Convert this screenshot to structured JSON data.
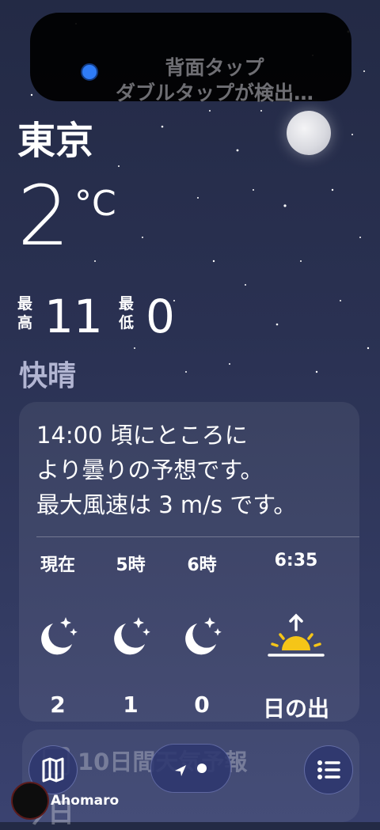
{
  "notification": {
    "line1": "背面タップ",
    "line2": "ダブルタップが検出…"
  },
  "weather": {
    "city": "東京",
    "temperature": "2",
    "degree_unit": "°C",
    "high_label": "最高",
    "high_value": "11",
    "low_label": "最低",
    "low_value": "0",
    "condition": "快晴"
  },
  "hourly_card": {
    "summary_line1": "14:00 頃にところに",
    "summary_line2": "より曇りの予想です。",
    "summary_line3": "最大風速は 3 m/s です。",
    "hours": [
      {
        "label": "現在",
        "icon": "moon-stars-icon",
        "value": "2"
      },
      {
        "label": "5時",
        "icon": "moon-stars-icon",
        "value": "1"
      },
      {
        "label": "6時",
        "icon": "moon-stars-icon",
        "value": "0"
      },
      {
        "label": "6:35",
        "icon": "sunrise-icon",
        "value": "日の出"
      }
    ]
  },
  "forecast": {
    "title": "10日間天気予報",
    "today_label": "今日"
  },
  "watermark": "Ahomaro",
  "colors": {
    "accent_sun": "#f5c518",
    "condition_text": "#b2b5d2"
  }
}
